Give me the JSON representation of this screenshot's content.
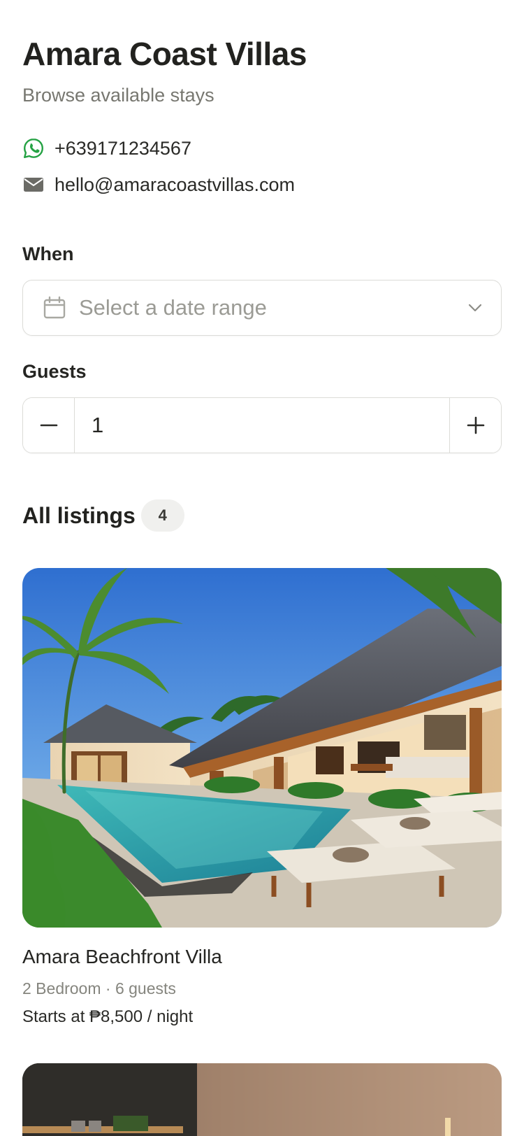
{
  "header": {
    "title": "Amara Coast Villas",
    "subtitle": "Browse available stays"
  },
  "contact": {
    "phone": "+639171234567",
    "phone_icon": "whatsapp-icon",
    "email": "hello@amaracoastvillas.com",
    "email_icon": "mail-icon"
  },
  "booking": {
    "when_label": "When",
    "date_placeholder": "Select a date range",
    "guests_label": "Guests",
    "guests_value": "1"
  },
  "listings": {
    "heading": "All listings",
    "count": "4",
    "items": [
      {
        "name": "Amara Beachfront Villa",
        "meta": "2 Bedroom · 6 guests",
        "price": "Starts at ₱8,500 / night"
      }
    ]
  },
  "colors": {
    "whatsapp_green": "#25a244",
    "muted_text": "#777770",
    "border": "#dcdcd8",
    "badge_bg": "#f0f0ee"
  }
}
